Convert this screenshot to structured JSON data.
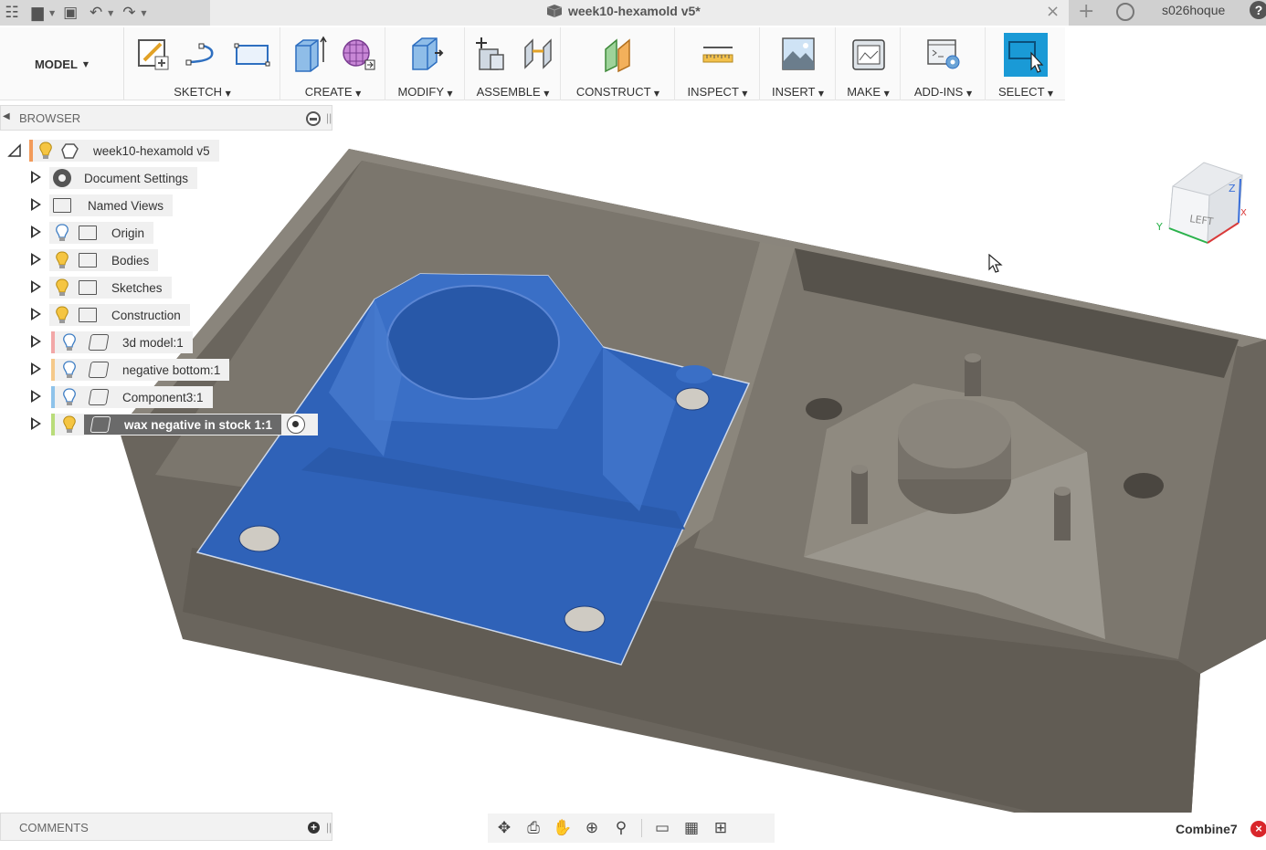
{
  "titlebar": {
    "document_title": "week10-hexamold v5*",
    "user_name": "s026hoque",
    "help_icon": "?",
    "new_tab_icon": "+",
    "close_icon": "×"
  },
  "toolbar": {
    "workspace": "MODEL",
    "groups": [
      {
        "label": "SKETCH"
      },
      {
        "label": "CREATE"
      },
      {
        "label": "MODIFY"
      },
      {
        "label": "ASSEMBLE"
      },
      {
        "label": "CONSTRUCT"
      },
      {
        "label": "INSPECT"
      },
      {
        "label": "INSERT"
      },
      {
        "label": "MAKE"
      },
      {
        "label": "ADD-INS"
      },
      {
        "label": "SELECT"
      }
    ]
  },
  "browser": {
    "title": "BROWSER",
    "root": "week10-hexamold v5",
    "items": [
      {
        "label": "Document Settings",
        "icon": "gear-icon"
      },
      {
        "label": "Named Views",
        "icon": "folder-icon"
      },
      {
        "label": "Origin",
        "icon": "folder-icon",
        "bulb": "off"
      },
      {
        "label": "Bodies",
        "icon": "folder-icon",
        "bulb": "on"
      },
      {
        "label": "Sketches",
        "icon": "folder-icon",
        "bulb": "on"
      },
      {
        "label": "Construction",
        "icon": "folder-icon",
        "bulb": "on"
      },
      {
        "label": "3d model:1",
        "icon": "component-icon",
        "bulb": "off",
        "color": "#f2a7a7"
      },
      {
        "label": "negative bottom:1",
        "icon": "component-icon",
        "bulb": "off",
        "color": "#f5c98a"
      },
      {
        "label": "Component3:1",
        "icon": "component-icon",
        "bulb": "off",
        "color": "#8ec3ea"
      },
      {
        "label": "wax negative in stock 1:1",
        "icon": "component-icon",
        "bulb": "on",
        "color": "#b9dc7a",
        "active": true
      }
    ]
  },
  "comments": {
    "title": "COMMENTS"
  },
  "status": {
    "command": "Combine7"
  },
  "viewcube": {
    "face_label": "LEFT",
    "axis_x": "X",
    "axis_y": "Y",
    "axis_z": "Z"
  },
  "colors": {
    "selection_blue": "#2f62b8",
    "stock_gray": "#6f6a62",
    "select_accent": "#1a9ad6"
  }
}
